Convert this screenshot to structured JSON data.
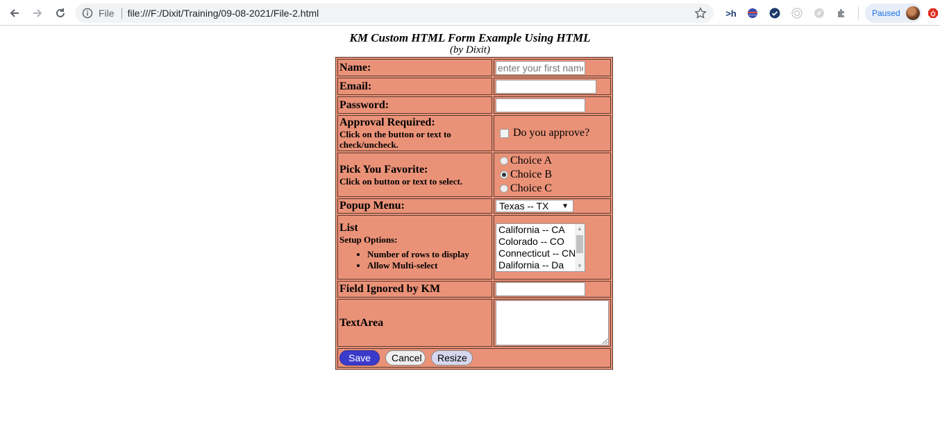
{
  "browser": {
    "file_label": "File",
    "url": "file:///F:/Dixit/Training/09-08-2021/File-2.html",
    "profile_status": "Paused"
  },
  "page": {
    "title": "KM Custom HTML Form Example Using HTML",
    "subtitle": "(by Dixit)"
  },
  "form": {
    "name_label": "Name:",
    "name_placeholder": "enter your first name",
    "email_label": "Email:",
    "password_label": "Password:",
    "approval_label": "Approval Required:",
    "approval_sub": "Click on the button or text to check/uncheck.",
    "approval_checkbox_text": "Do you approve?",
    "favorite_label": "Pick You Favorite:",
    "favorite_sub": "Click on button or text to select.",
    "favorite_options": [
      "Choice A",
      "Choice B",
      "Choice C"
    ],
    "favorite_selected": "Choice B",
    "popup_label": "Popup Menu:",
    "popup_selected": "Texas -- TX",
    "list_label": "List",
    "list_sub": "Setup Options:",
    "list_bullets": [
      "Number of rows to display",
      "Allow Multi-select"
    ],
    "list_options": [
      "California -- CA",
      "Colorado -- CO",
      "Connecticut -- CN",
      "Dalifornia -- Da"
    ],
    "ignored_label": "Field Ignored by KM",
    "textarea_label": "TextArea",
    "buttons": {
      "save": "Save",
      "cancel": "Cancel",
      "resize": "Resize"
    }
  }
}
